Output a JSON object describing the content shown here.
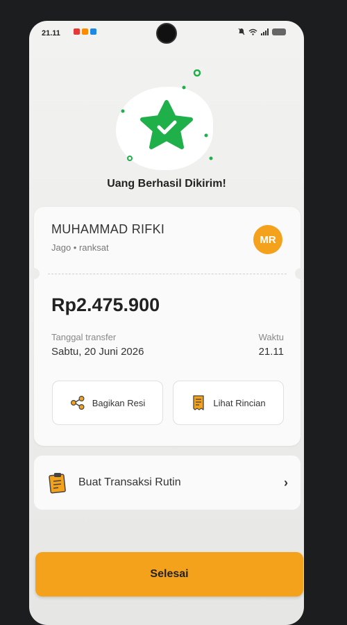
{
  "status_bar": {
    "time": "21.11"
  },
  "success": {
    "title": "Uang Berhasil Dikirim!"
  },
  "recipient": {
    "name": "MUHAMMAD RIFKI",
    "bank_info": "Jago • ranksat",
    "initials": "MR"
  },
  "transfer": {
    "amount": "Rp2.475.900",
    "date_label": "Tanggal transfer",
    "date_value": "Sabtu, 20 Juni 2026",
    "time_label": "Waktu",
    "time_value": "21.11"
  },
  "actions": {
    "share_label": "Bagikan Resi",
    "detail_label": "Lihat Rincian"
  },
  "routine": {
    "label": "Buat Transaksi Rutin"
  },
  "done_button": {
    "label": "Selesai"
  },
  "colors": {
    "accent": "#f4a11b",
    "success": "#1fb04a"
  },
  "icons": {
    "share": "share-icon",
    "detail": "receipt-icon",
    "routine": "clipboard-icon",
    "chevron": "chevron-right-icon",
    "success": "star-check-icon"
  }
}
